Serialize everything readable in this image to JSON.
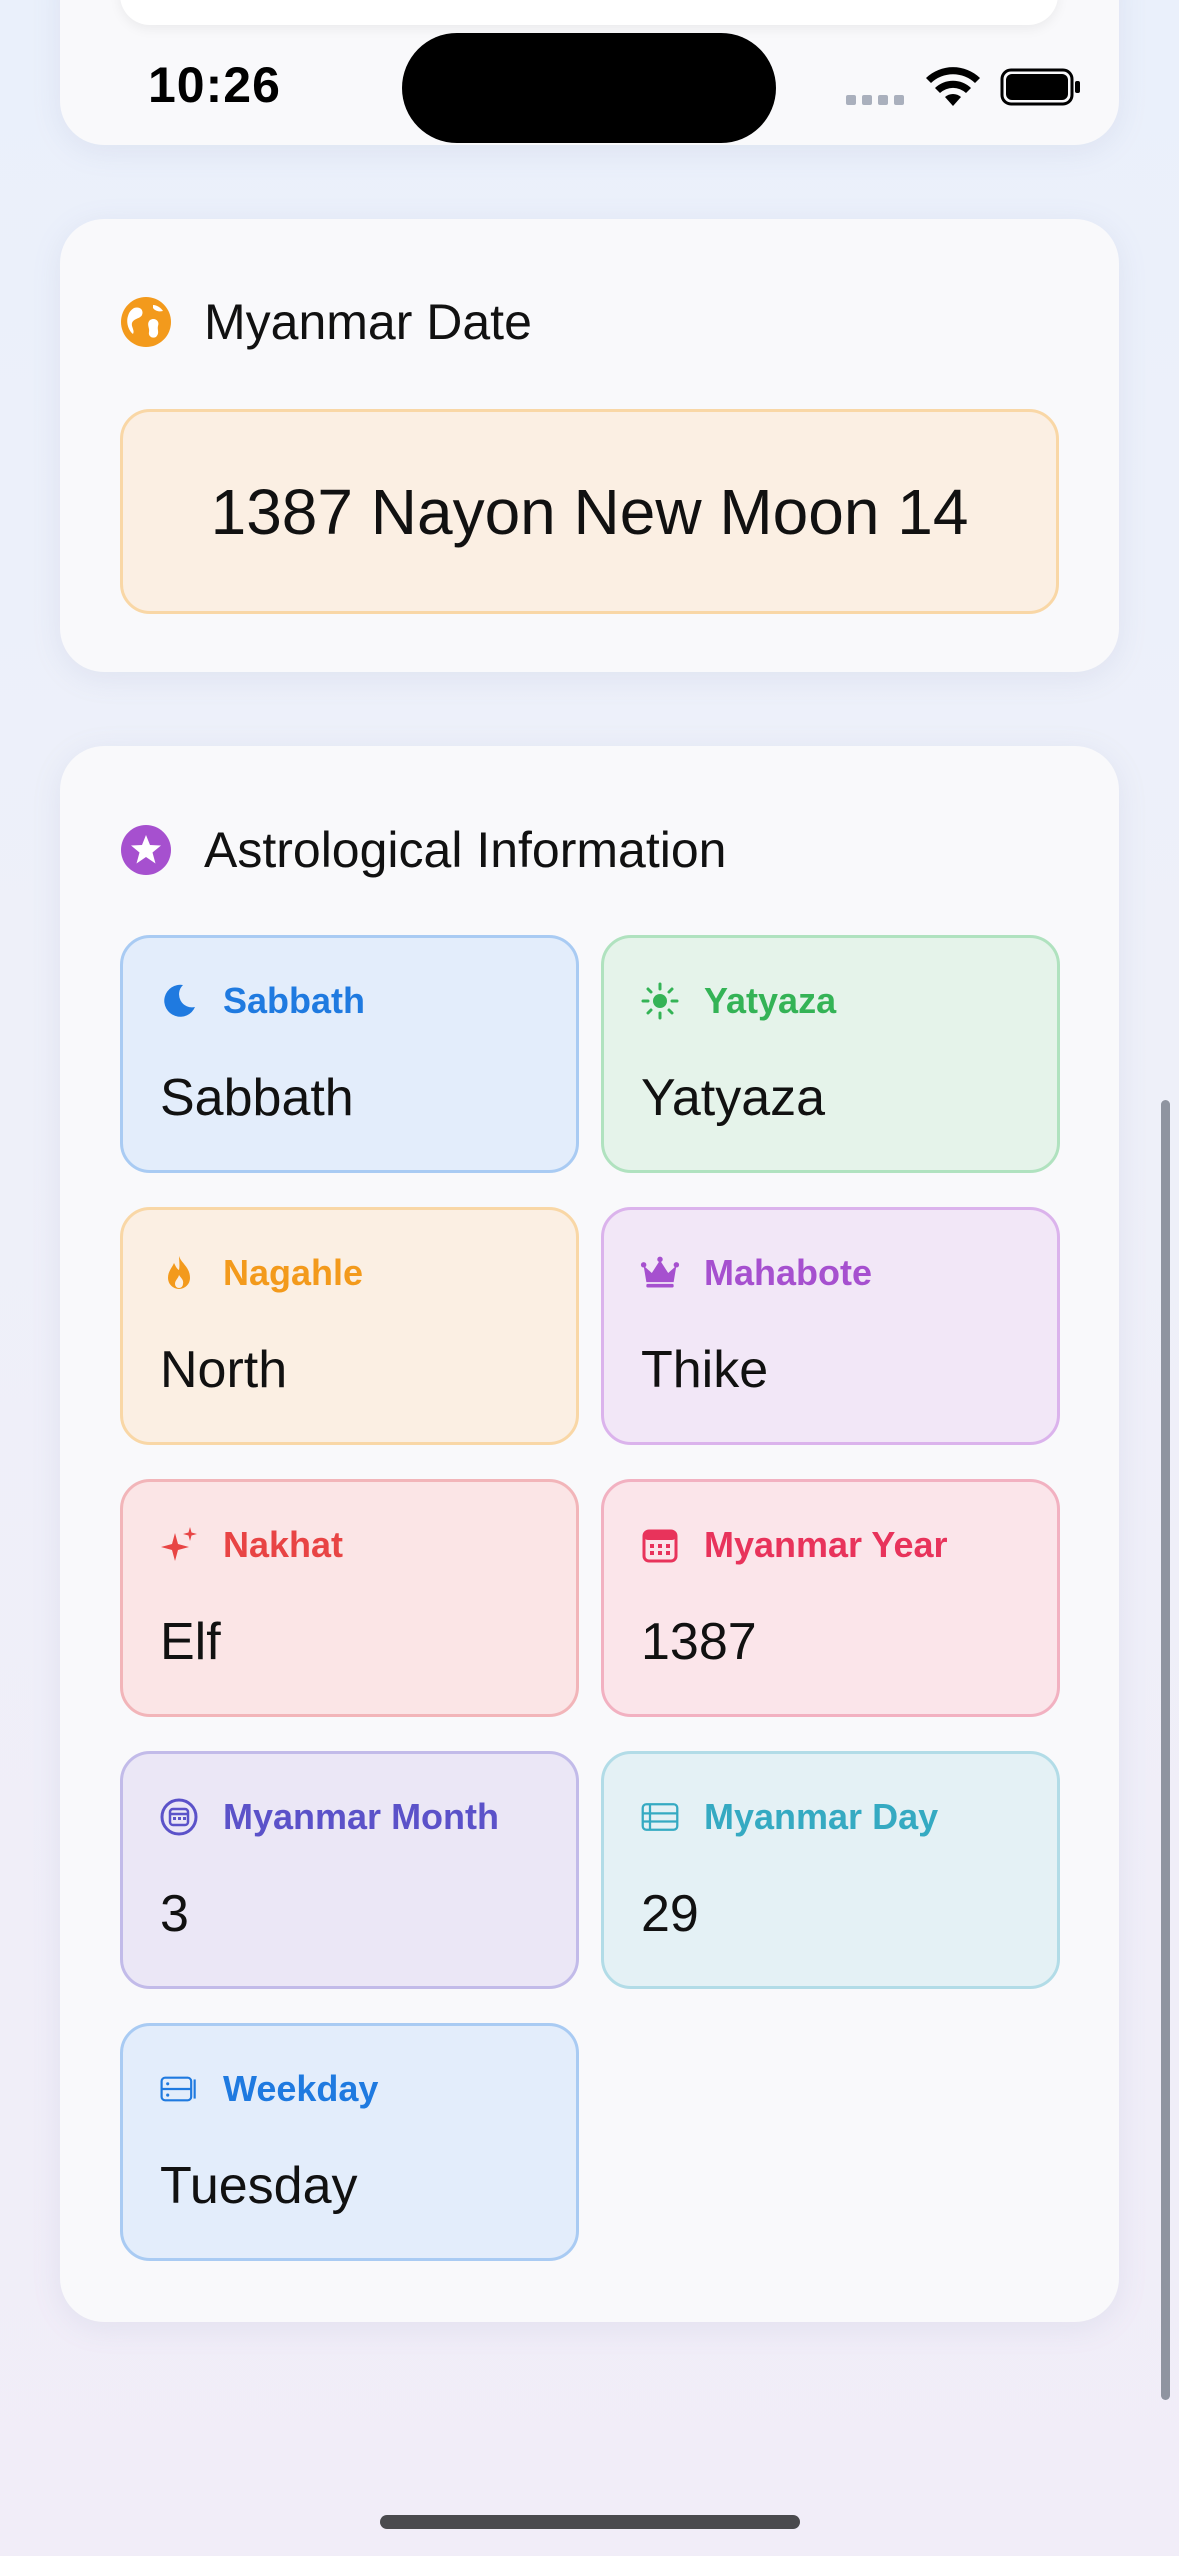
{
  "status_bar": {
    "time": "10:26"
  },
  "top_card": {
    "partial_text": ""
  },
  "myanmar_date": {
    "title": "Myanmar Date",
    "value": "1387 Nayon New Moon 14",
    "accent": "#f39a1c"
  },
  "astro": {
    "title": "Astrological Information",
    "accent": "#a650cf",
    "tiles": [
      {
        "label": "Sabbath",
        "value": "Sabbath",
        "icon": "moon-icon",
        "color": "#1f7ae0"
      },
      {
        "label": "Yatyaza",
        "value": "Yatyaza",
        "icon": "sun-icon",
        "color": "#34b356"
      },
      {
        "label": "Nagahle",
        "value": "North",
        "icon": "flame-icon",
        "color": "#f39a1c"
      },
      {
        "label": "Mahabote",
        "value": "Thike",
        "icon": "crown-icon",
        "color": "#a650cf"
      },
      {
        "label": "Nakhat",
        "value": "Elf",
        "icon": "sparkles-icon",
        "color": "#e84444"
      },
      {
        "label": "Myanmar Year",
        "value": "1387",
        "icon": "calendar-icon",
        "color": "#e8335b"
      },
      {
        "label": "Myanmar Month",
        "value": "3",
        "icon": "calendar-circle-icon",
        "color": "#5b52c9"
      },
      {
        "label": "Myanmar Day",
        "value": "29",
        "icon": "list-rows-icon",
        "color": "#35aac2"
      },
      {
        "label": "Weekday",
        "value": "Tuesday",
        "icon": "weekday-icon",
        "color": "#1f7ae0"
      }
    ]
  }
}
